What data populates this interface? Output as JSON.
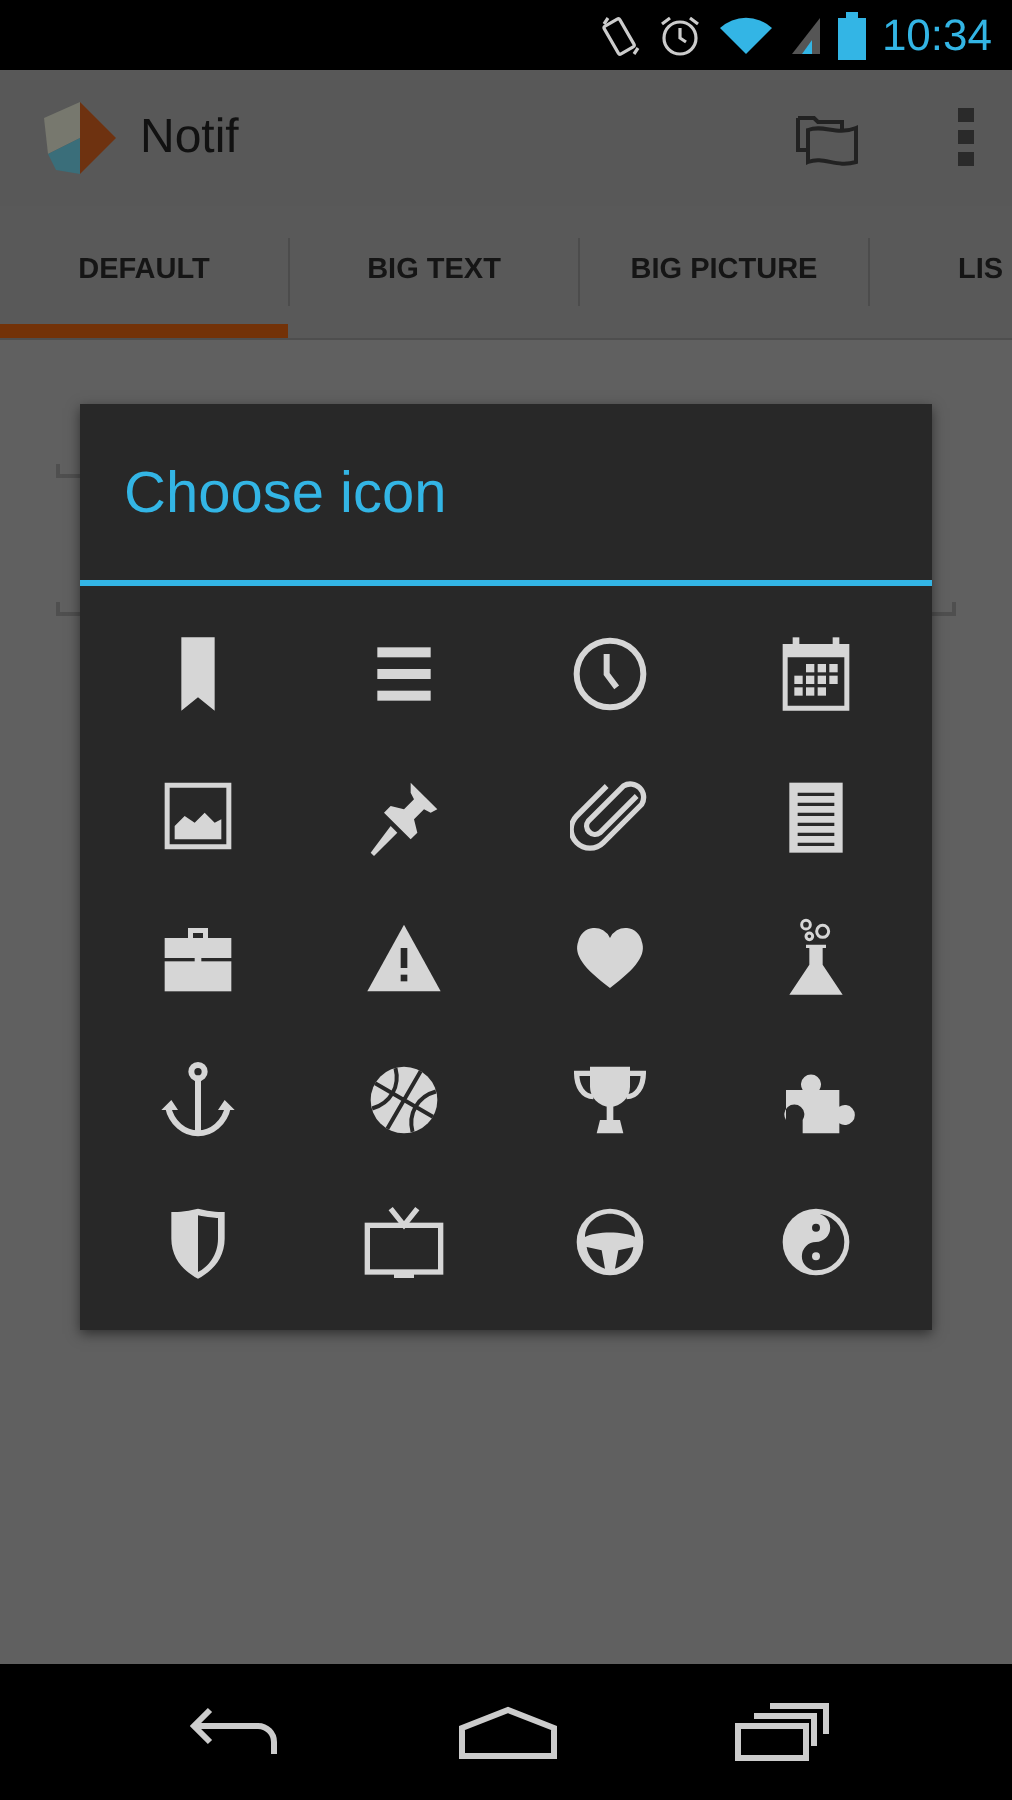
{
  "status_bar": {
    "time": "10:34"
  },
  "app_bar": {
    "title": "Notif"
  },
  "tabs": [
    {
      "label": "DEFAULT",
      "selected": true
    },
    {
      "label": "BIG TEXT",
      "selected": false
    },
    {
      "label": "BIG PICTURE",
      "selected": false
    },
    {
      "label": "LIS",
      "selected": false
    }
  ],
  "dialog": {
    "title": "Choose icon"
  }
}
